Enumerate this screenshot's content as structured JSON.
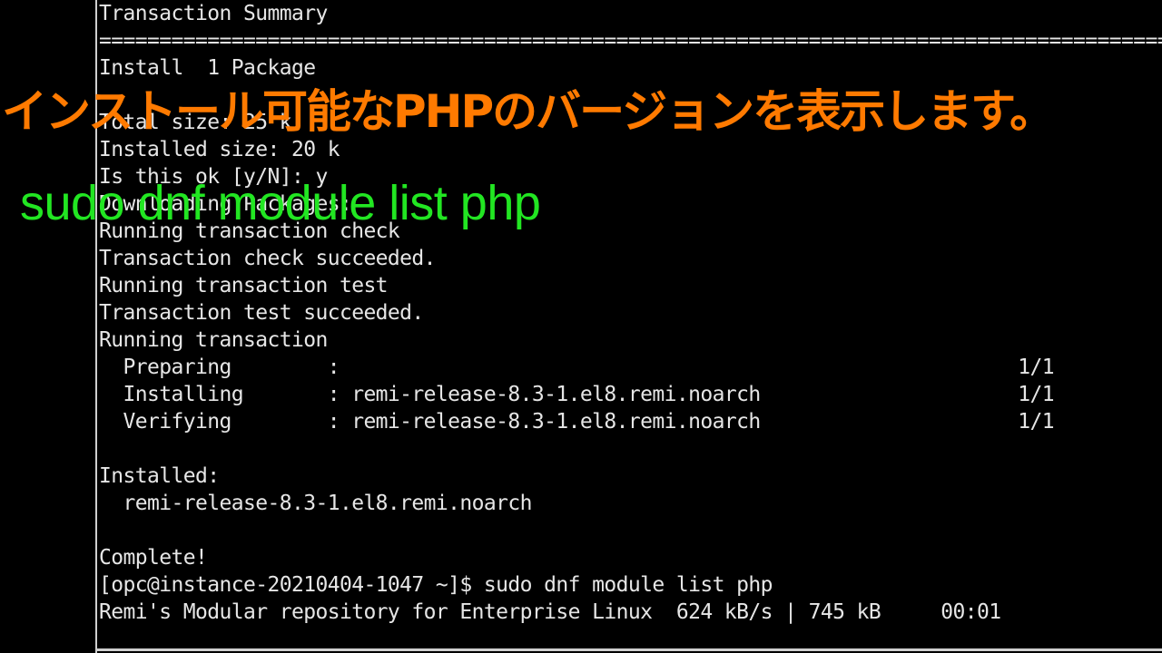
{
  "terminal": {
    "lines": {
      "transaction_summary": "Transaction Summary",
      "separator": "=========================================================================================",
      "install_count": "Install  1 Package",
      "total_size": "Total size: 25 k",
      "installed_size": "Installed size: 20 k",
      "is_this_ok": "Is this ok [y/N]: y",
      "downloading": "Downloading Packages:",
      "running_check": "Running transaction check",
      "check_succeeded": "Transaction check succeeded.",
      "running_test": "Running transaction test",
      "test_succeeded": "Transaction test succeeded.",
      "running_transaction": "Running transaction",
      "preparing": "  Preparing        :",
      "preparing_progress": "1/1",
      "installing": "  Installing       : remi-release-8.3-1.el8.remi.noarch",
      "installing_progress": "1/1",
      "verifying": "  Verifying        : remi-release-8.3-1.el8.remi.noarch",
      "verifying_progress": "1/1",
      "installed_header": "Installed:",
      "installed_package": "  remi-release-8.3-1.el8.remi.noarch",
      "complete": "Complete!",
      "prompt_command": "[opc@instance-20210404-1047 ~]$ sudo dnf module list php",
      "remi_repo": "Remi's Modular repository for Enterprise Linux  624 kB/s | 745 kB     00:01"
    }
  },
  "overlay": {
    "caption_jp": "インストール可能なPHPのバージョンを表示します。",
    "caption_command": "sudo dnf module list php"
  },
  "colors": {
    "background": "#000000",
    "terminal_text": "#e6e6e6",
    "caption_jp": "#ff7a00",
    "caption_command": "#22e622"
  }
}
